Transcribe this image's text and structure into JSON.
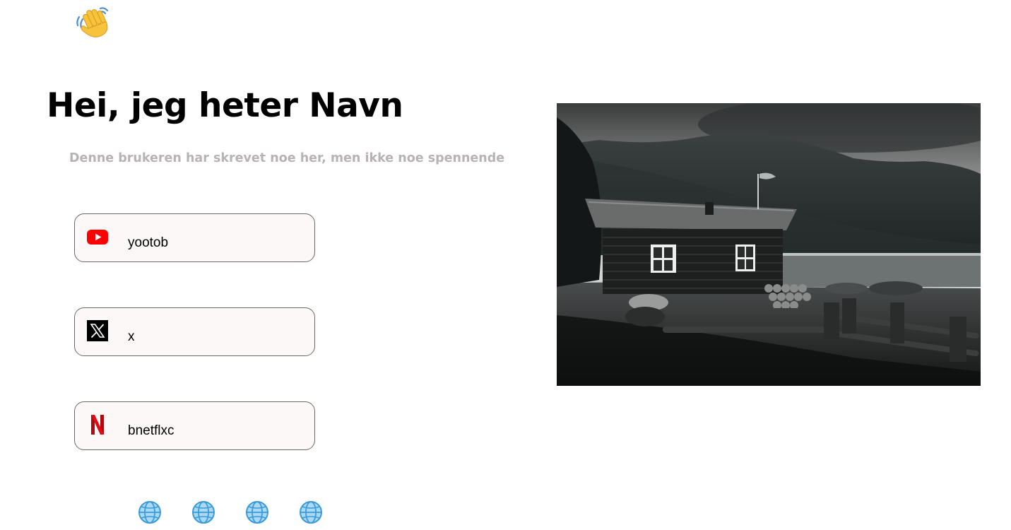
{
  "header": {
    "wave_icon": "waving-hand-icon",
    "title": "Hei, jeg heter Navn",
    "subtitle": "Denne brukeren har skrevet noe her, men ikke noe spennende"
  },
  "links": [
    {
      "icon": "youtube-icon",
      "label": "yootob"
    },
    {
      "icon": "x-icon",
      "label": "x"
    },
    {
      "icon": "netflix-icon",
      "label": "bnetflxc"
    }
  ],
  "photo": {
    "subject": "cabin-by-fjord-photo"
  },
  "footer": {
    "globe_icons": [
      "globe-icon",
      "globe-icon",
      "globe-icon",
      "globe-icon"
    ]
  },
  "colors": {
    "subtitle": "#b9b2b2",
    "card_background": "#fcf8f8",
    "card_border": "#6e6767",
    "youtube_red": "#ff0000",
    "netflix_red": "#e50914"
  }
}
